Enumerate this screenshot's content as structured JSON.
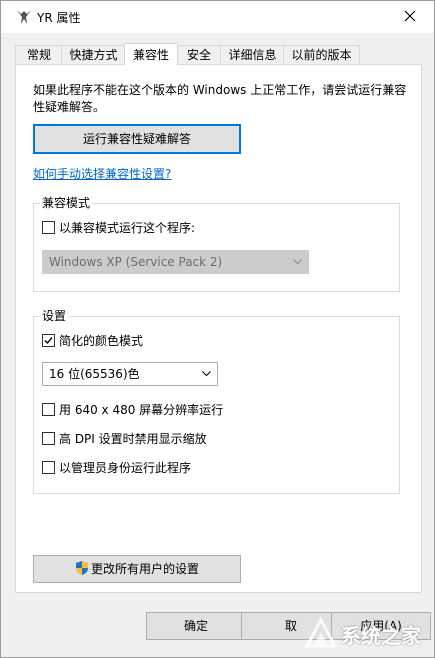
{
  "window": {
    "title": "YR 属性"
  },
  "tabs": [
    {
      "label": "常规"
    },
    {
      "label": "快捷方式"
    },
    {
      "label": "兼容性"
    },
    {
      "label": "安全"
    },
    {
      "label": "详细信息"
    },
    {
      "label": "以前的版本"
    }
  ],
  "active_tab": "兼容性",
  "compat": {
    "intro": "如果此程序不能在这个版本的 Windows 上正常工作，请尝试运行兼容性疑难解答。",
    "troubleshooter_button": "运行兼容性疑难解答",
    "manual_link": "如何手动选择兼容性设置?",
    "mode_group_title": "兼容模式",
    "mode_checkbox": "以兼容模式运行这个程序:",
    "mode_checked": false,
    "mode_select_value": "Windows XP (Service Pack 2)",
    "settings_group_title": "设置",
    "reduced_color_checkbox": "简化的颜色模式",
    "reduced_color_checked": true,
    "color_select_value": "16 位(65536)色",
    "res_checkbox": "用 640 x 480 屏幕分辨率运行",
    "res_checked": false,
    "dpi_checkbox": "高 DPI 设置时禁用显示缩放",
    "dpi_checked": false,
    "admin_checkbox": "以管理员身份运行此程序",
    "admin_checked": false,
    "all_users_button": "更改所有用户的设置"
  },
  "buttons": {
    "ok": "确定",
    "cancel": "取",
    "apply": "应用(A)"
  },
  "watermark": {
    "text": "系统之家"
  },
  "colors": {
    "accent": "#0078d7",
    "link": "#0066cc"
  }
}
